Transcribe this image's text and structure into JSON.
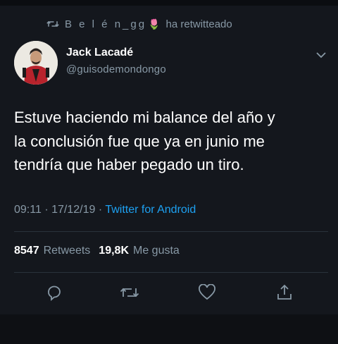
{
  "retweet_banner": {
    "user": "B e l é n_gg",
    "action": "ha retwitteado",
    "flower_emoji": "🌷"
  },
  "author": {
    "display_name": "Jack Lacadé",
    "handle": "@guisodemondongo"
  },
  "tweet": {
    "line1": "Estuve haciendo mi balance del año y",
    "line2": "la conclusión fue que ya en junio me",
    "line3": "tendría que haber pegado un tiro."
  },
  "meta": {
    "time": "09:11",
    "date": "17/12/19",
    "source": "Twitter for Android",
    "sep": "·"
  },
  "stats": {
    "retweets_count": "8547",
    "retweets_label": "Retweets",
    "likes_count": "19,8K",
    "likes_label": "Me gusta"
  },
  "colors": {
    "background": "#14171d",
    "muted": "#8899a6",
    "link": "#1da1f2",
    "divider": "#2a323b"
  },
  "icons": [
    "retweet-icon",
    "chevron-down-icon",
    "reply-icon",
    "retweet-action-icon",
    "like-icon",
    "share-icon"
  ]
}
